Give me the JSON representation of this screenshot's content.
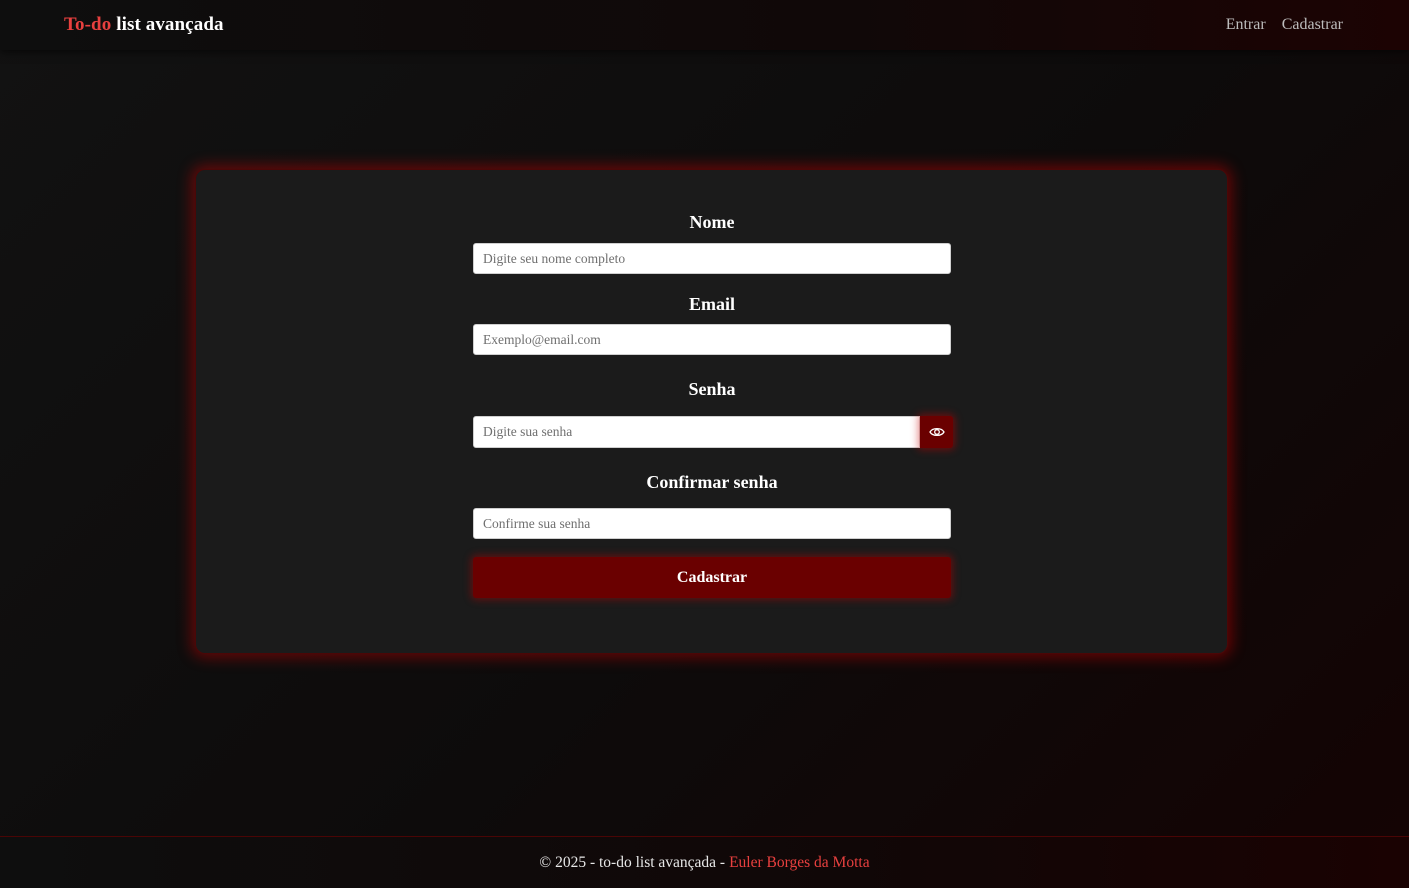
{
  "navbar": {
    "brand_accent": "To-do",
    "brand_rest": "list avançada",
    "links": [
      "Entrar",
      "Cadastrar"
    ]
  },
  "form": {
    "name_label": "Nome",
    "name_placeholder": "Digite seu nome completo",
    "email_label": "Email",
    "email_placeholder": "Exemplo@email.com",
    "password_label": "Senha",
    "password_placeholder": "Digite sua senha",
    "password_toggle_icon": "eye-icon",
    "confirm_label": "Confirmar senha",
    "confirm_placeholder": "Confirme sua senha",
    "submit_label": "Cadastrar"
  },
  "footer": {
    "text": "© 2025 - to-do list avançada -",
    "author": "Euler Borges da Motta"
  },
  "colors": {
    "accent": "#e8403f",
    "button": "#6a0000",
    "card": "#1b1b1b",
    "background": "#121212"
  }
}
